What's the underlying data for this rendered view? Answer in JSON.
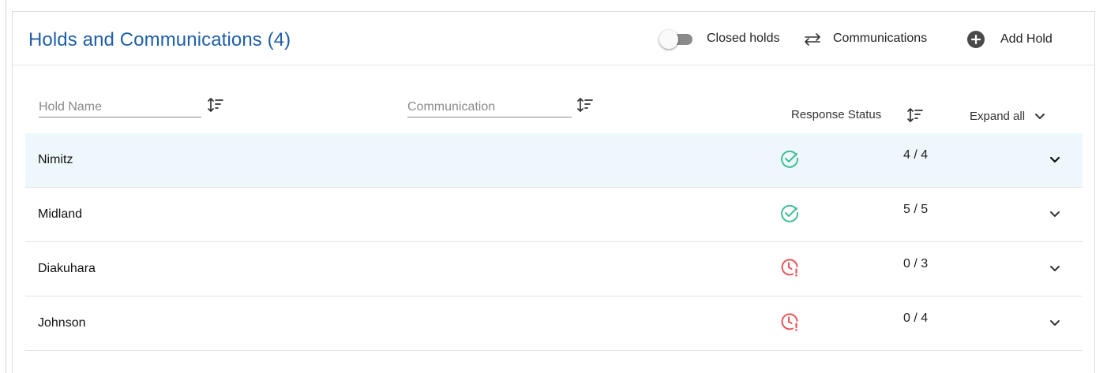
{
  "header": {
    "title": "Holds and Communications (4)",
    "closed_holds_label": "Closed holds",
    "closed_holds_on": false,
    "communications_label": "Communications",
    "add_hold_label": "Add Hold"
  },
  "filters": {
    "hold_name_placeholder": "Hold Name",
    "communication_placeholder": "Communication",
    "response_status_label": "Response Status",
    "expand_all_label": "Expand all"
  },
  "rows": [
    {
      "name": "Nimitz",
      "status": "complete",
      "count": "4 / 4",
      "selected": true
    },
    {
      "name": "Midland",
      "status": "complete",
      "count": "5 / 5",
      "selected": false
    },
    {
      "name": "Diakuhara",
      "status": "pending",
      "count": "0 / 3",
      "selected": false
    },
    {
      "name": "Johnson",
      "status": "pending",
      "count": "0 / 4",
      "selected": false
    }
  ],
  "colors": {
    "title": "#1f5fa8",
    "complete": "#3fbf94",
    "pending": "#e8545a",
    "selected_row": "#eef7fb"
  },
  "icons": {
    "complete": "check-circle-icon",
    "pending": "clock-alert-icon"
  }
}
